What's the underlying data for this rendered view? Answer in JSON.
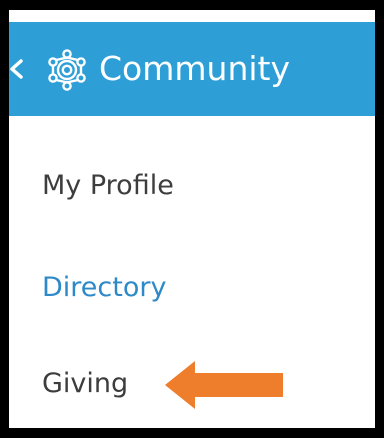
{
  "colors": {
    "frame": "#000000",
    "header_bg": "#2d9fd6",
    "header_text": "#ffffff",
    "menu_text": "#3d3d3d",
    "menu_active": "#2d89c8",
    "arrow": "#ee7d2c"
  },
  "header": {
    "back_icon": "chevron-left-icon",
    "icon": "community-network-icon",
    "title": "Community"
  },
  "menu": {
    "items": [
      {
        "label": "My Profile",
        "active": false
      },
      {
        "label": "Directory",
        "active": true
      },
      {
        "label": "Giving",
        "active": false
      }
    ]
  },
  "annotation": {
    "icon": "arrow-left-icon"
  }
}
